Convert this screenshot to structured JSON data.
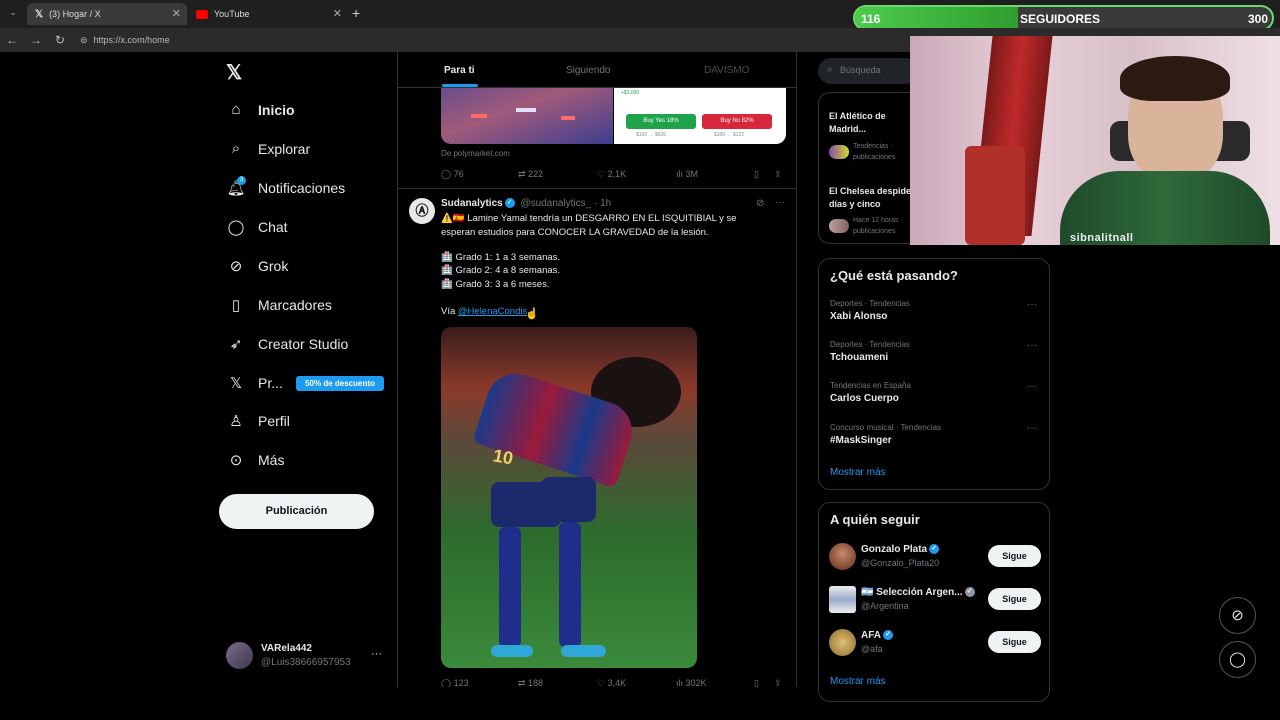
{
  "browser": {
    "tabs": [
      {
        "title": "(3) Hogar / X",
        "active": true
      },
      {
        "title": "YouTube",
        "active": false
      }
    ],
    "new_tab_icon": "plus-icon",
    "url": "https://x.com/home"
  },
  "overlay": {
    "followers_count": "116",
    "followers_label": "SEGUIDORES",
    "followers_goal": "300",
    "progress_fraction": 0.39
  },
  "sidebar": {
    "logo": "x-logo-icon",
    "items": [
      {
        "label": "Inicio",
        "icon": "home-icon"
      },
      {
        "label": "Explorar",
        "icon": "search-icon"
      },
      {
        "label": "Notificaciones",
        "icon": "bell-icon"
      },
      {
        "label": "Chat",
        "icon": "chat-icon"
      },
      {
        "label": "Grok",
        "icon": "grok-icon"
      },
      {
        "label": "Marcadores",
        "icon": "bookmark-icon"
      },
      {
        "label": "Creator Studio",
        "icon": "rocket-icon"
      },
      {
        "label": "Pr...",
        "icon": "x-premium-icon"
      },
      {
        "label": "Perfil",
        "icon": "person-icon"
      },
      {
        "label": "Más",
        "icon": "more-circle-icon"
      }
    ],
    "premium_badge": "50% de descuento",
    "post_button": "Publicación",
    "user": {
      "name": "VARela442",
      "handle": "@Luis38666957953",
      "more": "···"
    }
  },
  "timeline": {
    "tabs": [
      "Para ti",
      "Siguiendo",
      "DAVISMO"
    ],
    "prev_post": {
      "poll_buttons": [
        "Buy Yes 18%",
        "Buy No 82%"
      ],
      "poll_sub": [
        "$100 → $526",
        "$100 → $122"
      ],
      "poll_top": "+$2,000",
      "source": "De polymarket.com",
      "stats": {
        "replies": "76",
        "reposts": "222",
        "likes": "2,1K",
        "views": "3M"
      }
    },
    "post": {
      "author": "Sudanalytics",
      "handle": "@sudanalytics_",
      "time": "· 1h",
      "line1": "⚠️🇪🇸 Lamine Yamal tendría un DESGARRO EN EL ISQUITIBIAL y se esperan estudios para CONOCER LA GRAVEDAD de la lesión.",
      "grade1": "🏥 Grado 1: 1 a 3 semanas.",
      "grade2": "🏥 Grado 2: 4 a 8 semanas.",
      "grade3": "🏥 Grado 3: 3 a 6 meses.",
      "via": "Vía ",
      "via_link": "@HelenaCondis",
      "shirt_number": "10",
      "stats": {
        "replies": "123",
        "reposts": "188",
        "likes": "3,4K",
        "views": "302K"
      }
    }
  },
  "right": {
    "search_placeholder": "Búsqueda",
    "news": [
      {
        "title": "El Atlético de Madrid... rendimiento con",
        "meta": "Tendencias · publicaciones"
      },
      {
        "title": "El Chelsea despide... días y cinco derrotas",
        "meta": "Hace 12 horas · publicaciones"
      }
    ],
    "trends_title": "¿Qué está pasando?",
    "trends": [
      {
        "meta": "Deportes · Tendencias",
        "name": "Xabi Alonso"
      },
      {
        "meta": "Deportes · Tendencias",
        "name": "Tchouameni"
      },
      {
        "meta": "Tendencias en España",
        "name": "Carlos Cuerpo"
      },
      {
        "meta": "Concurso musical · Tendencias",
        "name": "#MaskSinger"
      }
    ],
    "show_more": "Mostrar más",
    "follow_title": "A quién seguir",
    "accounts": [
      {
        "name": "Gonzalo Plata",
        "handle": "@Gonzalo_Plata20",
        "button": "Sigue"
      },
      {
        "name": "🇦🇷 Selección Argen...",
        "handle": "@Argentina",
        "button": "Sigue"
      },
      {
        "name": "AFA",
        "handle": "@afa",
        "button": "Sigue"
      }
    ],
    "show_more_2": "Mostrar más"
  },
  "webcam": {
    "shirt_text": "sibnalitnall"
  },
  "colors": {
    "accent": "#1d9bf0",
    "background": "#000000",
    "follower_green": "#4ccb4c",
    "poll_yes": "#1fa34a",
    "poll_no": "#d6283a"
  }
}
